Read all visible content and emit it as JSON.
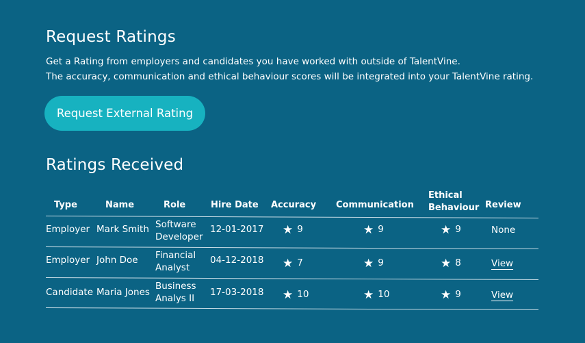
{
  "request": {
    "title": "Request Ratings",
    "description_1": "Get a Rating from employers and candidates you have worked with outside of TalentVine.",
    "description_2": "The accuracy, communication and ethical behaviour scores will be integrated into your TalentVine rating.",
    "button_label": "Request External Rating"
  },
  "received": {
    "title": "Ratings Received",
    "headers": {
      "type": "Type",
      "name": "Name",
      "role": "Role",
      "hire_date": "Hire Date",
      "accuracy": "Accuracy",
      "communication": "Communication",
      "ethical_1": "Ethical",
      "ethical_2": "Behaviour",
      "review": "Review"
    },
    "rows": [
      {
        "type": "Employer",
        "name": "Mark Smith",
        "role_1": "Software",
        "role_2": "Developer",
        "hire_date": "12-01-2017",
        "accuracy": "9",
        "communication": "9",
        "ethical": "9",
        "review": "None"
      },
      {
        "type": "Employer",
        "name": "John Doe",
        "role_1": "Financial",
        "role_2": "Analyst",
        "hire_date": "04-12-2018",
        "accuracy": "7",
        "communication": "9",
        "ethical": "8",
        "review": "View"
      },
      {
        "type": "Candidate",
        "name": "Maria Jones",
        "role_1": "Business",
        "role_2": "Analys II",
        "hire_date": "17-03-2018",
        "accuracy": "10",
        "communication": "10",
        "ethical": "9",
        "review": "View"
      }
    ]
  },
  "icons": {
    "score": "star-icon"
  },
  "colors": {
    "background": "#0b6384",
    "button": "#17b2c0",
    "text": "#ffffff"
  }
}
